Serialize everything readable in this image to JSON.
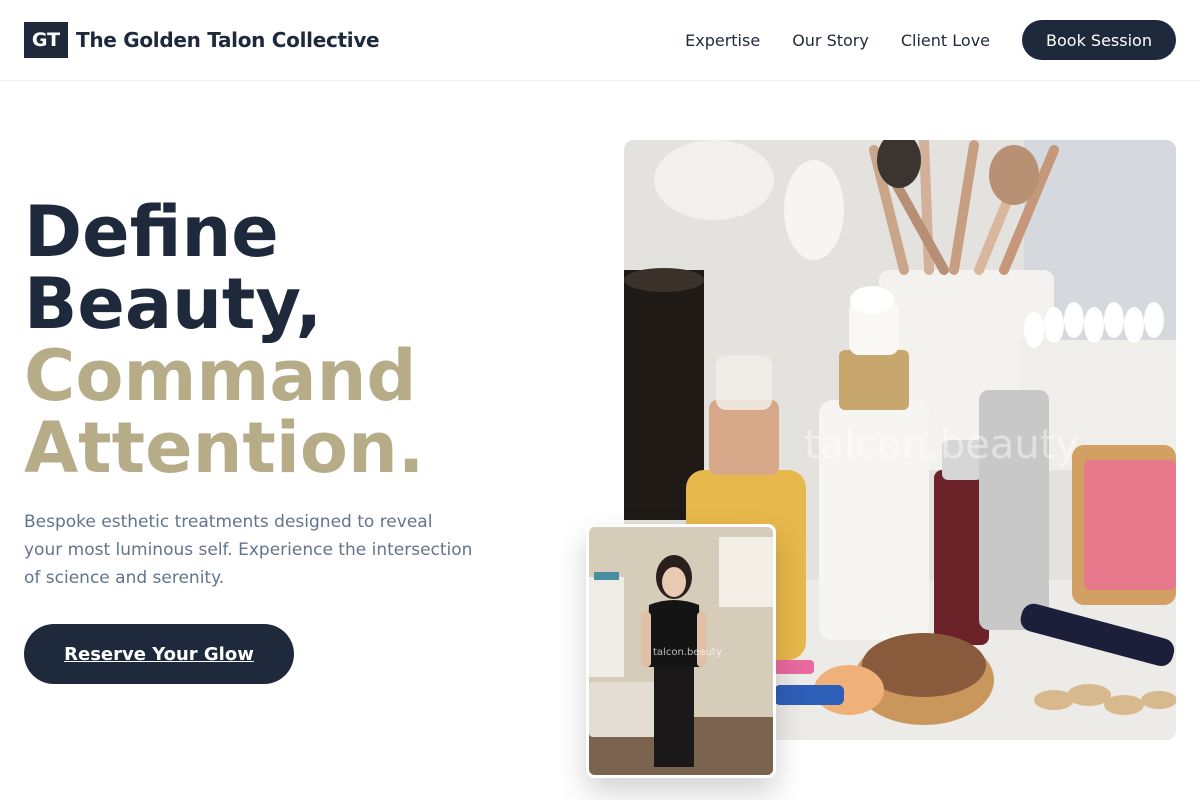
{
  "brand": {
    "mark": "GT",
    "name": "The Golden Talon Collective"
  },
  "nav": {
    "items": [
      {
        "label": "Expertise"
      },
      {
        "label": "Our Story"
      },
      {
        "label": "Client Love"
      }
    ],
    "cta_label": "Book Session"
  },
  "hero": {
    "title_line1": "Define",
    "title_line2": "Beauty,",
    "title_line3": "Command",
    "title_line4": "Attention.",
    "description": "Bespoke esthetic treatments designed to reveal your most luminous self. Experience the intersection of science and serenity.",
    "cta_label": "Reserve Your Glow",
    "image_watermark": "talcon.beauty",
    "portrait_watermark": "talcon.beauty"
  },
  "colors": {
    "primary": "#1e293b",
    "accent_gold": "#b6ad88",
    "muted_text": "#64748b"
  }
}
